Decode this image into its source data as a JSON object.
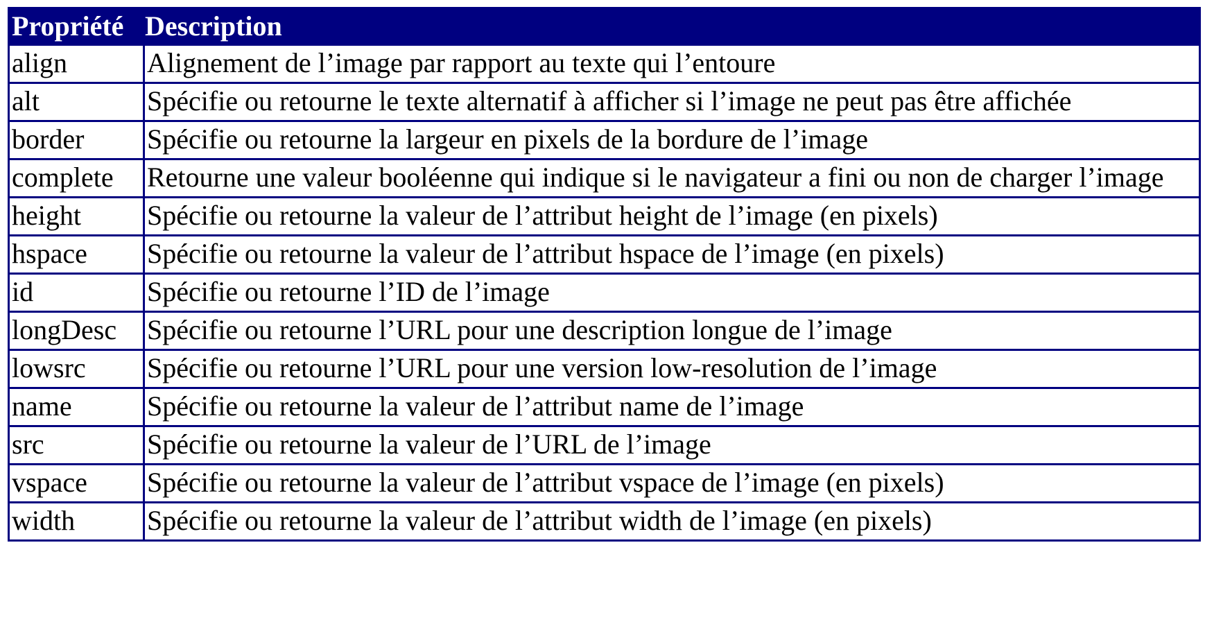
{
  "table": {
    "headers": [
      "Propriété",
      "Description"
    ],
    "rows": [
      {
        "property": "align",
        "description": "Alignement de l’image par rapport au texte qui l’entoure"
      },
      {
        "property": "alt",
        "description": "Spécifie ou retourne le texte alternatif à afficher si l’image ne peut pas être affichée"
      },
      {
        "property": "border",
        "description": "Spécifie ou retourne la largeur en pixels de la bordure de l’image"
      },
      {
        "property": "complete",
        "description": "Retourne une valeur booléenne qui indique si le navigateur a fini ou non de charger l’image"
      },
      {
        "property": "height",
        "description": "Spécifie ou retourne la valeur de l’attribut height de l’image (en pixels)"
      },
      {
        "property": "hspace",
        "description": "Spécifie ou retourne la valeur de l’attribut hspace de l’image (en pixels)"
      },
      {
        "property": "id",
        "description": "Spécifie ou retourne l’ID de l’image"
      },
      {
        "property": "longDesc",
        "description": "Spécifie ou retourne l’URL pour une description longue de l’image"
      },
      {
        "property": "lowsrc",
        "description": "Spécifie ou retourne l’URL pour une version low-resolution de l’image"
      },
      {
        "property": "name",
        "description": "Spécifie ou retourne la valeur de l’attribut name de l’image"
      },
      {
        "property": "src",
        "description": "Spécifie ou retourne la valeur de l’URL de l’image"
      },
      {
        "property": "vspace",
        "description": "Spécifie ou retourne la valeur de l’attribut vspace de l’image (en pixels)"
      },
      {
        "property": "width",
        "description": "Spécifie ou retourne la valeur de l’attribut width de l’image (en pixels)"
      }
    ]
  },
  "colors": {
    "header_bg": "#000080",
    "border": "#000080",
    "header_text": "#ffffff"
  }
}
